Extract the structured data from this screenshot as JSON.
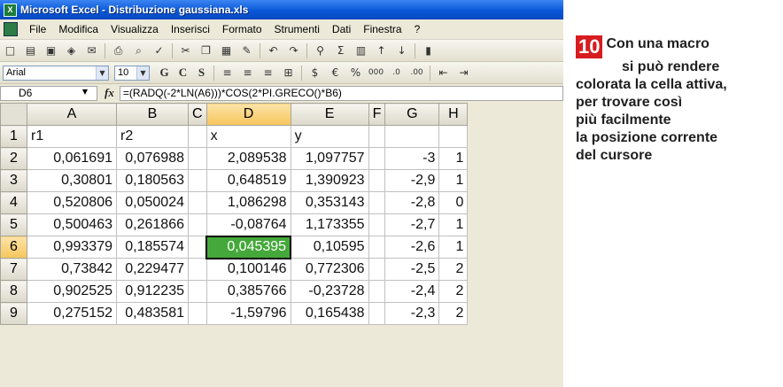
{
  "window": {
    "title": "Microsoft Excel - Distribuzione gaussiana.xls"
  },
  "menu": [
    "File",
    "Modifica",
    "Visualizza",
    "Inserisci",
    "Formato",
    "Strumenti",
    "Dati",
    "Finestra",
    "?"
  ],
  "toolbar": {
    "font_name": "Arial",
    "font_size": "10",
    "bold": "G",
    "italic": "C",
    "underline": "S",
    "percent": "%",
    "thousands": "000",
    "euro": "€",
    "sigma": "Σ"
  },
  "formula_bar": {
    "name_box": "D6",
    "fx": "fx",
    "formula": "=(RADQ(-2*LN(A6)))*COS(2*PI.GRECO()*B6)"
  },
  "sheet": {
    "columns": [
      "A",
      "B",
      "C",
      "D",
      "E",
      "F",
      "G",
      "H"
    ],
    "selected_column": "D",
    "active_cell": "D6",
    "active_cell_color": "#45a83a",
    "rows": [
      {
        "n": "1",
        "A": "r1",
        "B": "r2",
        "C": "",
        "D": "x",
        "E": "y",
        "F": "",
        "G": "",
        "H": ""
      },
      {
        "n": "2",
        "A": "0,061691",
        "B": "0,076988",
        "C": "",
        "D": "2,089538",
        "E": "1,097757",
        "F": "",
        "G": "-3",
        "H": "1"
      },
      {
        "n": "3",
        "A": "0,30801",
        "B": "0,180563",
        "C": "",
        "D": "0,648519",
        "E": "1,390923",
        "F": "",
        "G": "-2,9",
        "H": "1"
      },
      {
        "n": "4",
        "A": "0,520806",
        "B": "0,050024",
        "C": "",
        "D": "1,086298",
        "E": "0,353143",
        "F": "",
        "G": "-2,8",
        "H": "0"
      },
      {
        "n": "5",
        "A": "0,500463",
        "B": "0,261866",
        "C": "",
        "D": "-0,08764",
        "E": "1,173355",
        "F": "",
        "G": "-2,7",
        "H": "1"
      },
      {
        "n": "6",
        "A": "0,993379",
        "B": "0,185574",
        "C": "",
        "D": "0,045395",
        "E": "0,10595",
        "F": "",
        "G": "-2,6",
        "H": "1"
      },
      {
        "n": "7",
        "A": "0,73842",
        "B": "0,229477",
        "C": "",
        "D": "0,100146",
        "E": "0,772306",
        "F": "",
        "G": "-2,5",
        "H": "2"
      },
      {
        "n": "8",
        "A": "0,902525",
        "B": "0,912235",
        "C": "",
        "D": "0,385766",
        "E": "-0,23728",
        "F": "",
        "G": "-2,4",
        "H": "2"
      },
      {
        "n": "9",
        "A": "0,275152",
        "B": "0,483581",
        "C": "",
        "D": "-1,59796",
        "E": "0,165438",
        "F": "",
        "G": "-2,3",
        "H": "2"
      }
    ]
  },
  "callout": {
    "number": "10",
    "number_color": "#d61c1f",
    "line1": "Con una macro",
    "line2": "si può rendere",
    "line3": "colorata la cella attiva,",
    "line4": "per trovare così",
    "line5": "più facilmente",
    "line6": "la posizione corrente",
    "line7": "del cursore"
  }
}
